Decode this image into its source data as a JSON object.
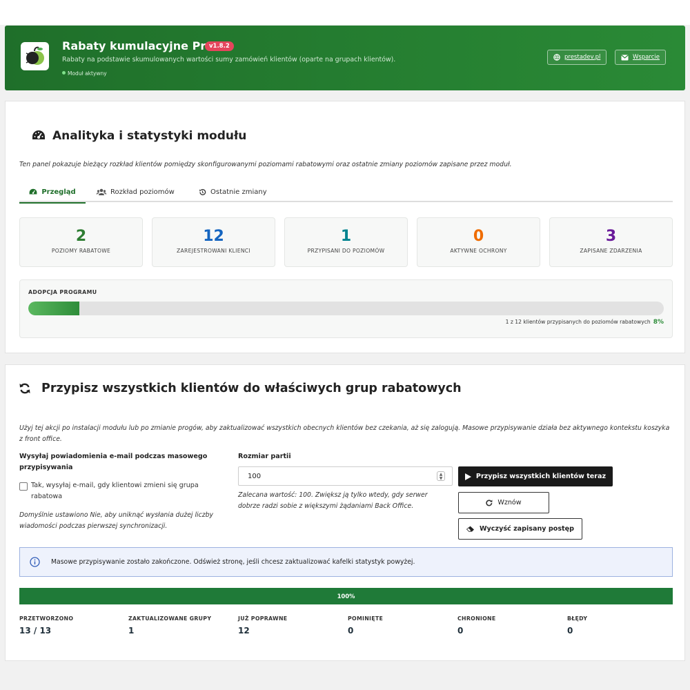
{
  "header": {
    "title": "Rabaty kumulacyjne Pro",
    "version": "v1.8.2",
    "subtitle": "Rabaty na podstawie skumulowanych wartości sumy zamówień klientów (oparte na grupach klientów).",
    "status": "Moduł aktywny",
    "link_site": "prestadev.pl",
    "link_support": "Wsparcie"
  },
  "analytics": {
    "title": "Analityka i statystyki modułu",
    "description": "Ten panel pokazuje bieżący rozkład klientów pomiędzy skonfigurowanymi poziomami rabatowymi oraz ostatnie zmiany poziomów zapisane przez moduł.",
    "tabs": [
      {
        "label": "Przegląd",
        "icon": "tachometer-icon"
      },
      {
        "label": "Rozkład poziomów",
        "icon": "users-icon"
      },
      {
        "label": "Ostatnie zmiany",
        "icon": "history-icon"
      }
    ],
    "stats": [
      {
        "value": "2",
        "label": "POZIOMY RABATOWE",
        "color": "#2e7d32"
      },
      {
        "value": "12",
        "label": "ZAREJESTROWANI KLIENCI",
        "color": "#1565c0"
      },
      {
        "value": "1",
        "label": "PRZYPISANI DO POZIOMÓW",
        "color": "#00838f"
      },
      {
        "value": "0",
        "label": "AKTYWNE OCHRONY",
        "color": "#ef6c00"
      },
      {
        "value": "3",
        "label": "ZAPISANE ZDARZENIA",
        "color": "#6a1b9a"
      }
    ],
    "adoption": {
      "title": "ADOPCJA PROGRAMU",
      "percent": 8,
      "percent_label": "8%",
      "note": "1 z 12 klientów przypisanych do poziomów rabatowych"
    }
  },
  "assign": {
    "title": "Przypisz wszystkich klientów do właściwych grup rabatowych",
    "description": "Użyj tej akcji po instalacji modułu lub po zmianie progów, aby zaktualizować wszystkich obecnych klientów bez czekania, aż się zalogują. Masowe przypisywanie działa bez aktywnego kontekstu koszyka z front office.",
    "email_label": "Wysyłaj powiadomienia e-mail podczas masowego przypisywania",
    "email_checkbox": "Tak, wysyłaj e-mail, gdy klientowi zmieni się grupa rabatowa",
    "email_help": "Domyślnie ustawiono Nie, aby uniknąć wysłania dużej liczby wiadomości podczas pierwszej synchronizacji.",
    "batch_label": "Rozmiar partii",
    "batch_value": "100",
    "batch_help": "Zalecana wartość: 100. Zwiększ ją tylko wtedy, gdy serwer dobrze radzi sobie z większymi żądaniami Back Office.",
    "btn_run": "Przypisz wszystkich klientów teraz",
    "btn_resume": "Wznów",
    "btn_clear": "Wyczyść zapisany postęp",
    "info": "Masowe przypisywanie zostało zakończone. Odśwież stronę, jeśli chcesz zaktualizować kafelki statystyk powyżej.",
    "progress": 100,
    "progress_label": "100%",
    "results": [
      {
        "label": "PRZETWORZONO",
        "value": "13 / 13"
      },
      {
        "label": "ZAKTUALIZOWANE GRUPY",
        "value": "1"
      },
      {
        "label": "JUŻ POPRAWNE",
        "value": "12"
      },
      {
        "label": "POMINIĘTE",
        "value": "0"
      },
      {
        "label": "CHRONIONE",
        "value": "0"
      },
      {
        "label": "BŁĘDY",
        "value": "0"
      }
    ]
  }
}
